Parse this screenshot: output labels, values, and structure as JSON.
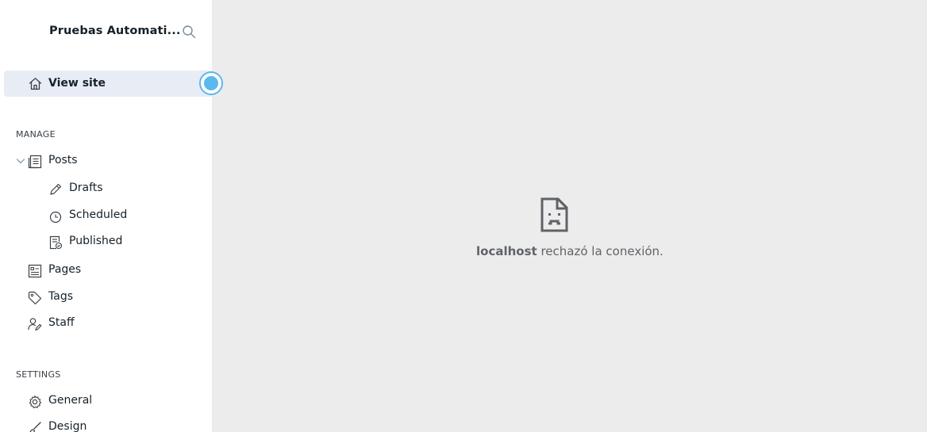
{
  "sidebar": {
    "site_title": "Pruebas Automati...",
    "view_site_label": "View site",
    "manage_section": "MANAGE",
    "settings_section": "SETTINGS",
    "items": {
      "posts": "Posts",
      "drafts": "Drafts",
      "scheduled": "Scheduled",
      "published": "Published",
      "pages": "Pages",
      "tags": "Tags",
      "staff": "Staff",
      "general": "General",
      "design": "Design"
    }
  },
  "main": {
    "error_host": "localhost",
    "error_message": "rechazó la conexión."
  },
  "colors": {
    "active_bg": "#e8ecf4",
    "pulse": "#5bb8f0",
    "content_bg": "#ececec"
  }
}
